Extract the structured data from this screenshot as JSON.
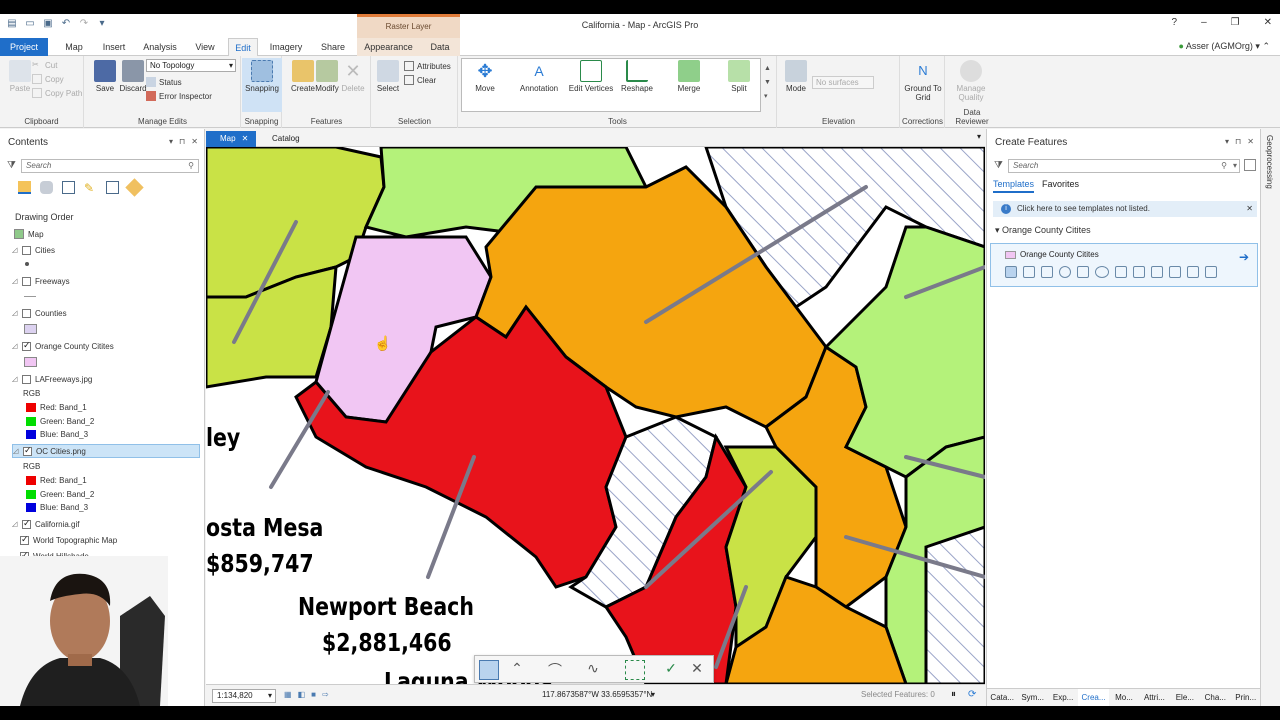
{
  "window": {
    "title": "California - Map - ArcGIS Pro",
    "context_tab_group": "Raster Layer",
    "help": "?",
    "minimize": "–",
    "restore": "❐",
    "close": "✕"
  },
  "tabs": [
    "Project",
    "Map",
    "Insert",
    "Analysis",
    "View",
    "Edit",
    "Imagery",
    "Share",
    "Appearance",
    "Data"
  ],
  "active_tab": "Edit",
  "user": "Asser (AGMOrg)",
  "ribbon": {
    "clipboard": {
      "paste": "Paste",
      "cut": "Cut",
      "copy": "Copy",
      "copy_path": "Copy Path",
      "label": "Clipboard"
    },
    "manage_edits": {
      "save": "Save",
      "discard": "Discard",
      "topology": "No Topology",
      "status": "Status",
      "error_inspector": "Error Inspector",
      "label": "Manage Edits"
    },
    "snapping": {
      "snapping": "Snapping",
      "label": "Snapping"
    },
    "features": {
      "create": "Create",
      "modify": "Modify",
      "delete": "Delete",
      "label": "Features"
    },
    "selection": {
      "select": "Select",
      "attributes": "Attributes",
      "clear": "Clear",
      "label": "Selection"
    },
    "tools": {
      "move": "Move",
      "annotation": "Annotation",
      "edit_vertices": "Edit Vertices",
      "reshape": "Reshape",
      "merge": "Merge",
      "split": "Split",
      "label": "Tools"
    },
    "elevation": {
      "mode": "Mode",
      "surfaces": "No surfaces",
      "label": "Elevation"
    },
    "corrections": {
      "ground_to_grid": "Ground To Grid",
      "label": "Corrections"
    },
    "data_reviewer": {
      "manage_quality": "Manage Quality",
      "label": "Data Reviewer"
    }
  },
  "contents": {
    "title": "Contents",
    "search_placeholder": "Search",
    "drawing_order": "Drawing Order",
    "map": "Map",
    "layers": {
      "cities": "Cities",
      "freeways": "Freeways",
      "counties": "Counties",
      "oc_cities": "Orange County Citites",
      "la_freeways": "LAFreeways.jpg",
      "rgb": "RGB",
      "red_band1": "Red:  Band_1",
      "green_band2": "Green: Band_2",
      "blue_band3": "Blue:  Band_3",
      "oc_png": "OC Cities.png",
      "california": "California.gif",
      "topo": "World Topographic Map",
      "hillshade": "World Hillshade"
    }
  },
  "mapview": {
    "tab_map": "Map",
    "tab_catalog": "Catalog",
    "labels": {
      "ley": "ley",
      "costa_mesa": "osta Mesa",
      "costa_mesa_value": "$859,747",
      "newport": "Newport Beach",
      "newport_value": "$2,881,466",
      "laguna": "Laguna Woods"
    },
    "scale": "1:134,820",
    "coords": "117.8673587°W 33.6595357°N",
    "selected_features": "Selected Features: 0"
  },
  "create_features": {
    "title": "Create Features",
    "search_placeholder": "Search",
    "tab_templates": "Templates",
    "tab_favorites": "Favorites",
    "info": "Click here to see templates not listed.",
    "group": "Orange County Citites",
    "template": "Orange County Citites"
  },
  "bottom_tabs": [
    "Cata...",
    "Sym...",
    "Exp...",
    "Crea...",
    "Mo...",
    "Attri...",
    "Ele...",
    "Cha...",
    "Prin..."
  ],
  "side_strip": "Geoprocessing",
  "colors": {
    "accent": "#1f6ec9",
    "red": "#e8131b",
    "orange": "#f5a50f",
    "green": "#b4f27a",
    "yellowgreen": "#c9e246",
    "pink": "#f1c6f3"
  }
}
